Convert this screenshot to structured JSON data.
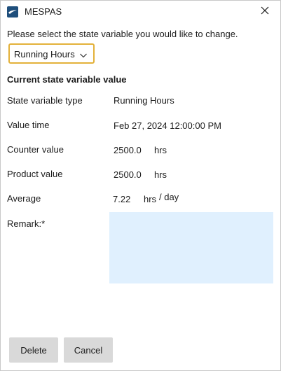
{
  "window": {
    "title": "MESPAS"
  },
  "form": {
    "instruction": "Please select the state variable you would like to change.",
    "selected_variable": "Running Hours",
    "section_heading": "Current state variable value"
  },
  "fields": {
    "type": {
      "label": "State variable type",
      "value": "Running Hours"
    },
    "time": {
      "label": "Value time",
      "value": "Feb 27, 2024 12:00:00 PM"
    },
    "counter": {
      "label": "Counter value",
      "value": "2500.0",
      "unit": "hrs"
    },
    "product": {
      "label": "Product value",
      "value": "2500.0",
      "unit": "hrs"
    },
    "average": {
      "label": "Average",
      "value": "7.22",
      "unit": "hrs",
      "per": "/ day"
    },
    "remark": {
      "label": "Remark:*",
      "value": ""
    }
  },
  "buttons": {
    "delete": "Delete",
    "cancel": "Cancel"
  },
  "colors": {
    "select_border": "#e3b13a",
    "remark_background": "#e0f0fe",
    "button_background": "#d9d9d9",
    "app_icon": "#1f4f7c"
  }
}
